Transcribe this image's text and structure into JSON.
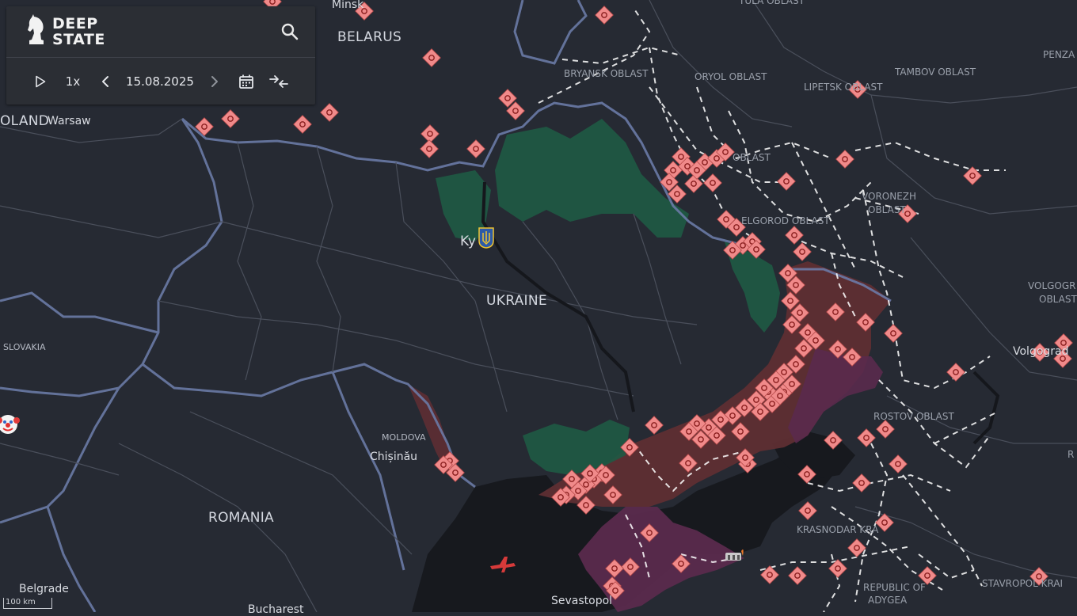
{
  "app": {
    "logo_line1": "DEEP",
    "logo_line2": "STATE"
  },
  "timeline": {
    "speed": "1x",
    "date": "15.08.2025"
  },
  "icons": [
    "knight-logo-icon",
    "search-icon",
    "play-icon",
    "chevron-left-icon",
    "chevron-right-icon",
    "calendar-icon",
    "collapse-arrows-icon",
    "clown-face-icon",
    "plane-icon",
    "bridge-icon"
  ],
  "labels": {
    "countries": {
      "belarus": "BELARUS",
      "ukraine": "UKRAINE",
      "romania": "ROMANIA",
      "moldova": "MOLDOVA",
      "slovakia": "SLOVAKIA",
      "poland": "OLAND"
    },
    "cities": {
      "minsk": "Minsk",
      "warsaw": "Warsaw",
      "kyiv": "Ky",
      "chisinau": "Chișinău",
      "belgrade": "Belgrade",
      "bucharest": "Bucharest",
      "sevastopol": "Sevastopol",
      "volgograd": "Volgograd"
    },
    "regions": {
      "tula": "TULA OBLAST",
      "bryansk": "BRYANSK OBLAST",
      "oryol": "ORYOL OBLAST",
      "lipetsk": "LIPETSK OBLAST",
      "tambov": "TAMBOV OBLAST",
      "penza": "PENZA",
      "kursk": "OBLAST",
      "voronezh_1": "VORONEZH",
      "voronezh_2": "OBLAST",
      "belgorod": "ELGOROD OBLAST",
      "volgograd_1": "VOLGOGR",
      "volgograd_2": "OBLAST",
      "rostov": "ROSTOV OBLAST",
      "krasnodar": "KRASNODAR KRA",
      "adygea_1": "REPUBLIC OF",
      "adygea_2": "ADYGEA",
      "stavropol": "STAVROPOL KRAI",
      "edge_r": "R"
    }
  },
  "scale": {
    "label": "100 km"
  },
  "colors": {
    "background": "#262a33",
    "sea": "#17191e",
    "border": "#6a7aa6",
    "occupied": "#5e2e33",
    "occupied_longterm": "#5a2a4d",
    "liberated": "#1f5a44",
    "marker": "#f08a8a",
    "railroad": "#ffffff"
  }
}
